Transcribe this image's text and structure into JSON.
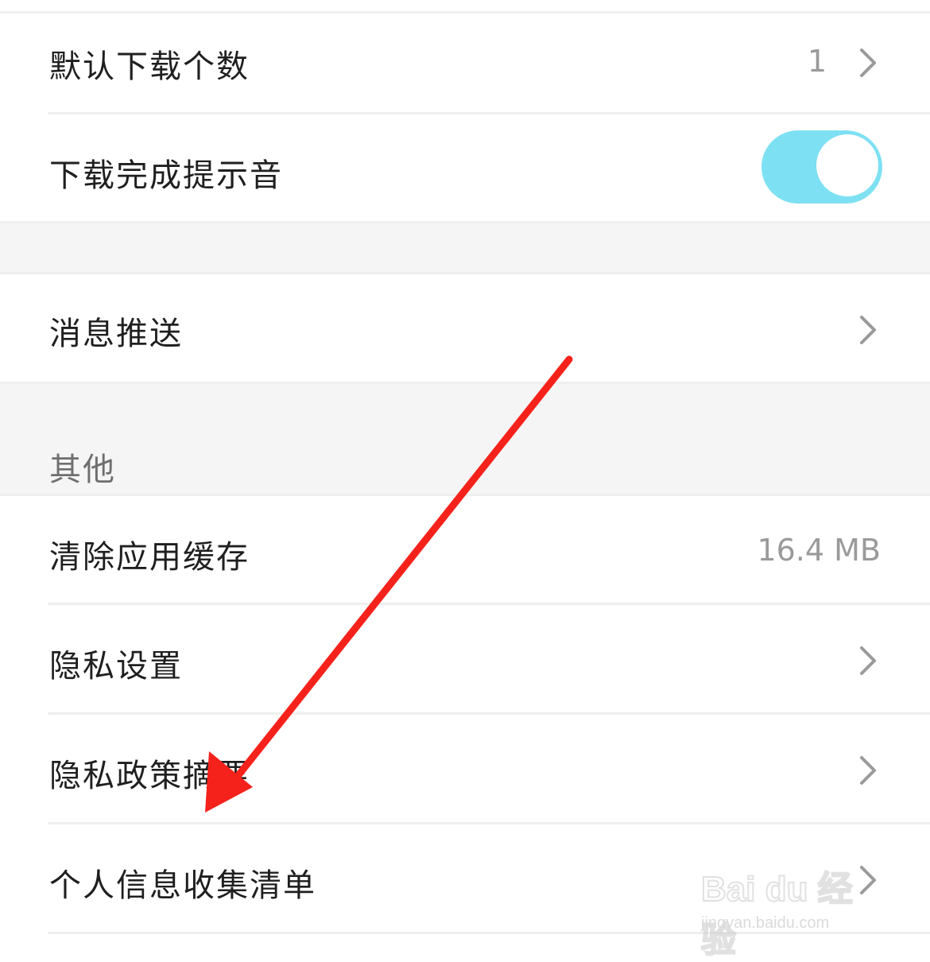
{
  "settings": {
    "default_download_count": {
      "label": "默认下载个数",
      "value": "1"
    },
    "download_complete_sound": {
      "label": "下载完成提示音",
      "enabled": true
    },
    "message_push": {
      "label": "消息推送"
    },
    "other_section": {
      "title": "其他"
    },
    "clear_cache": {
      "label": "清除应用缓存",
      "value": "16.4 MB"
    },
    "privacy_settings": {
      "label": "隐私设置"
    },
    "privacy_policy_summary": {
      "label": "隐私政策摘要"
    },
    "personal_info_list": {
      "label": "个人信息收集清单"
    }
  },
  "colors": {
    "toggle_on": "#7ee0f3",
    "annotation_arrow": "#f5221b",
    "background_gray": "#f5f5f5"
  },
  "watermark": {
    "brand": "Bai du 经验",
    "url": "jingyan.baidu.com"
  }
}
